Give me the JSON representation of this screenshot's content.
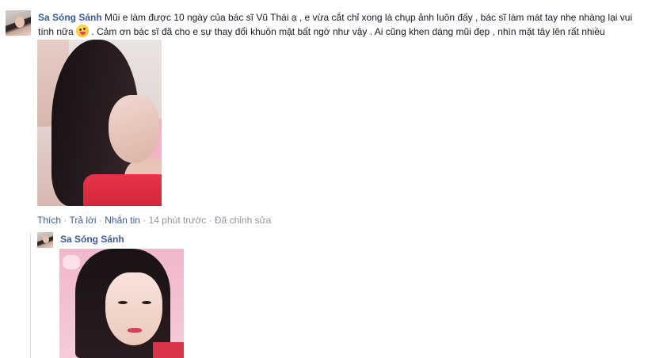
{
  "comment": {
    "author": "Sa Sóng Sánh",
    "text_part1": " Mũi e làm được 10 ngày của bác sĩ Vũ Thái ạ , e vừa cắt chỉ xong là chụp ảnh luôn đấy , bác sĩ làm mát tay nhẹ nhàng lại vui tính nữa ",
    "emoji_icon": "tongue-wink-emoji",
    "text_part2": " . Cảm ơn bác sĩ đã cho e sự thay đổi khuôn mặt bất ngờ như vậy . Ai cũng khen dáng mũi đẹp , nhìn mặt tây lên rất nhiều",
    "actions": {
      "like": "Thích",
      "reply": "Trả lời",
      "message": "Nhắn tin",
      "time": "14 phút trước",
      "edited": "Đã chỉnh sửa",
      "separator": " · "
    }
  },
  "reply": {
    "author": "Sa Sóng Sánh"
  },
  "colors": {
    "link": "#3b5998",
    "muted": "#90949c",
    "text": "#141823"
  }
}
